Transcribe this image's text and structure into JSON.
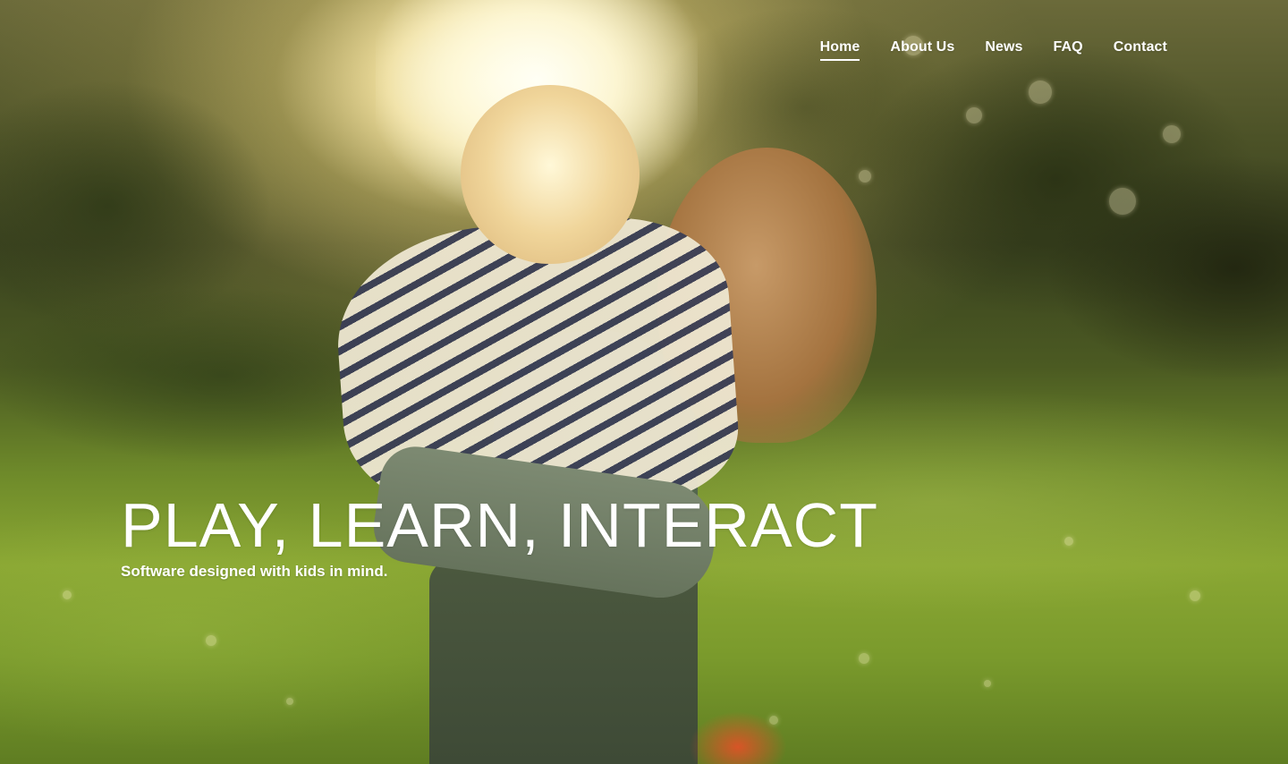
{
  "nav": {
    "items": [
      {
        "label": "Home",
        "active": true
      },
      {
        "label": "About Us",
        "active": false
      },
      {
        "label": "News",
        "active": false
      },
      {
        "label": "FAQ",
        "active": false
      },
      {
        "label": "Contact",
        "active": false
      }
    ]
  },
  "hero": {
    "title": "PLAY, LEARN, INTERACT",
    "subtitle": "Software designed with kids in mind.",
    "background_image": "sunlit-children-piggyback-in-field"
  },
  "colors": {
    "text": "#ffffff",
    "nav_underline": "#ffffff"
  }
}
